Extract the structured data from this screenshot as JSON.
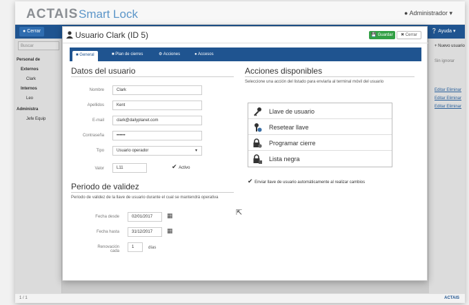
{
  "app": {
    "brand": "ACTAIS",
    "product": "Smart Lock",
    "user": "Administrador"
  },
  "navbar": {
    "cerrar": "Cerrar",
    "help": "Ayuda"
  },
  "background": {
    "search_placeholder": "Buscar",
    "tree": [
      "Personal de",
      "Externos",
      "Clark",
      "Internos",
      "Leo",
      "Administra",
      "Jefe Equip"
    ],
    "right_links": [
      "Editar Eliminar",
      "Editar Eliminar",
      "Editar Eliminar"
    ],
    "new_user": "+ Nuevo usuario",
    "ignore": "Sin ignorar",
    "status_left": "1 / 1",
    "status_right": "ACTAIS"
  },
  "modal": {
    "title": "Usuario Clark (ID 5)",
    "save": "Guardar",
    "close": "Cerrar",
    "tabs": [
      "General",
      "Plan de cierres",
      "Acciones",
      "Accesos"
    ],
    "section_user": "Datos del usuario",
    "fields": [
      {
        "label": "Nombre",
        "value": "Clark"
      },
      {
        "label": "Apellidos",
        "value": "Kent"
      },
      {
        "label": "E-mail",
        "value": "clark@dailyplanet.com"
      },
      {
        "label": "Contraseña",
        "value": "••••••"
      },
      {
        "label": "Tipo",
        "value": "Usuario operador"
      },
      {
        "label": "Valor",
        "value": "L11"
      }
    ],
    "active_label": "Activo",
    "section_validity": "Periodo de validez",
    "validity_desc": "Periodo de validez de la llave de usuario durante el cual se mantendrá operativa",
    "date_from_label": "Fecha desde",
    "date_from": "02/01/2017",
    "date_to_label": "Fecha hasta",
    "date_to": "31/12/2017",
    "renew_label": "Renovación cada",
    "renew_value": "1",
    "renew_unit": "días",
    "section_actions": "Acciones disponibles",
    "actions_desc": "Seleccione una acción del listado para enviarla al terminal móvil del usuario",
    "actions": [
      "Llave de usuario",
      "Resetear llave",
      "Programar cierre",
      "Lista negra"
    ],
    "auto_send": "Enviar llave de usuario automáticamente al realizar cambios"
  }
}
